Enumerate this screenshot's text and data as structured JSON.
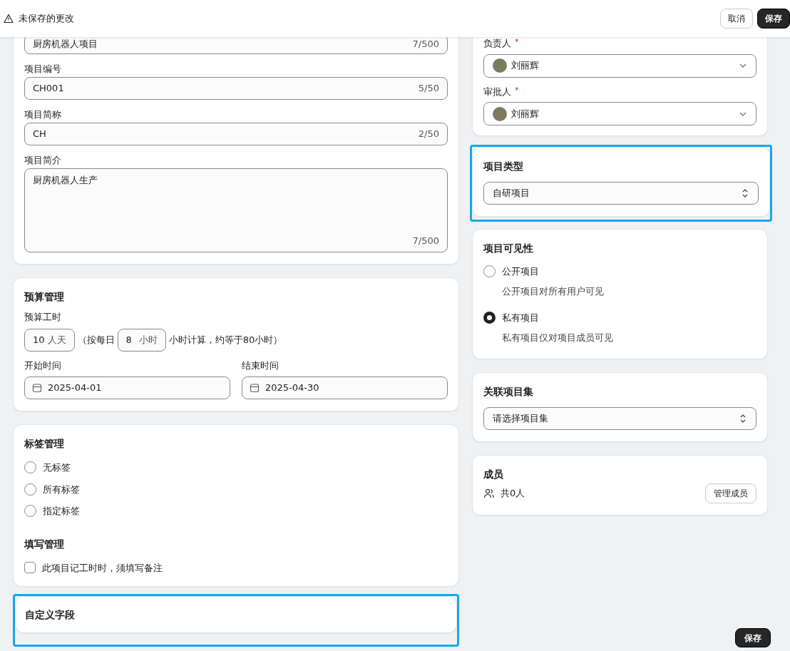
{
  "top_bar": {
    "warning": "未保存的更改",
    "buttons": [
      {
        "label": "取消",
        "kind": "secondary"
      },
      {
        "label": "保存",
        "kind": "primary"
      }
    ]
  },
  "basic_info": {
    "fields": [
      {
        "kind": "input",
        "value": "厨房机器人项目",
        "counter": "7/500"
      },
      {
        "kind": "input",
        "label": "项目编号",
        "value": "CH001",
        "counter": "5/50"
      },
      {
        "kind": "input",
        "label": "项目简称",
        "value": "CH",
        "counter": "2/50"
      },
      {
        "kind": "textarea",
        "label": "项目简介",
        "value": "厨房机器人生产",
        "counter": "7/500"
      }
    ]
  },
  "budget": {
    "title": "预算管理",
    "hours_label": "预算工时",
    "days_value": "10",
    "days_unit": "人天",
    "text_before": "（按每日",
    "hours_value": "8",
    "hours_unit": "小时",
    "text_after": "小时计算，约等于80小时）",
    "start_label": "开始时间",
    "start_value": "2025-04-01",
    "end_label": "结束时间",
    "end_value": "2025-04-30"
  },
  "tags": {
    "title": "标签管理",
    "options": [
      {
        "label": "无标签",
        "selected": false
      },
      {
        "label": "所有标签",
        "selected": false
      },
      {
        "label": "指定标签",
        "selected": false
      }
    ],
    "fill_title": "填写管理",
    "require_note": {
      "label": "此项目记工时时，须填写备注",
      "checked": false
    }
  },
  "custom_fields": {
    "title": "自定义字段",
    "highlighted": true
  },
  "people": {
    "fields": [
      {
        "label": "负责人",
        "required_mark": "*",
        "value": "刘丽辉"
      },
      {
        "label": "审批人",
        "required_mark": "*",
        "value": "刘丽辉"
      }
    ]
  },
  "project_type": {
    "title": "项目类型",
    "value": "自研项目",
    "highlighted": true
  },
  "visibility": {
    "title": "项目可见性",
    "options": [
      {
        "label": "公开项目",
        "description": "公开项目对所有用户可见",
        "selected": false
      },
      {
        "label": "私有项目",
        "description": "私有项目仅对项目成员可见",
        "selected": true
      }
    ]
  },
  "project_set": {
    "title": "关联项目集",
    "placeholder": "请选择项目集",
    "highlighted": false
  },
  "members": {
    "title": "成员",
    "count": "共0人",
    "button": "管理成员"
  },
  "footer": {
    "save": "保存"
  }
}
